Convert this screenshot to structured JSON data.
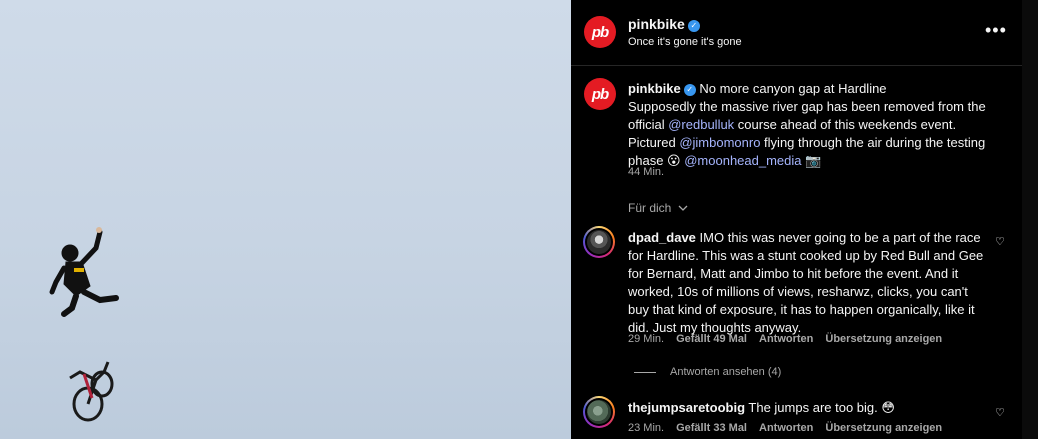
{
  "post": {
    "author": "pinkbike",
    "avatar_text": "pb",
    "subtitle": "Once it's gone it's gone",
    "more_label": "•••",
    "verified_mark": "✓"
  },
  "caption": {
    "author": "pinkbike",
    "part1": "No more canyon gap at Hardline",
    "part2": "Supposedly the massive river gap has been removed from the official ",
    "mention1": "@redbulluk",
    "part3": " course ahead of this weekends event. Pictured ",
    "mention2": "@jimbomonro",
    "part4": " flying through the air during the testing phase ",
    "emoji1": "😮",
    "mention3": "@moonhead_media",
    "emoji2": "📷",
    "time": "44 Min."
  },
  "filter": {
    "label": "Für dich",
    "icon": "chevron-down-icon"
  },
  "comments": [
    {
      "author": "dpad_dave",
      "text": "IMO this was never going to be a part of the race for Hardline. This was a stunt cooked up by Red Bull and Gee for Bernard, Matt and Jimbo to hit before the event. And it worked, 10s of millions of views, resharwz, clicks, you can't buy that kind of exposure, it has to happen organically, like it did. Just my thoughts anyway.",
      "time": "29 Min.",
      "likes": "Gefällt 49 Mal",
      "reply": "Antworten",
      "translate": "Übersetzung anzeigen",
      "view_replies": "Antworten ansehen (4)"
    },
    {
      "author": "thejumpsaretoobig",
      "text": "The jumps are too big. ",
      "emoji": "😳",
      "time": "23 Min.",
      "likes": "Gefällt 33 Mal",
      "reply": "Antworten",
      "translate": "Übersetzung anzeigen"
    }
  ],
  "icons": {
    "heart": "♡"
  },
  "colors": {
    "accent": "#e41b23",
    "verified": "#3897f0",
    "mention": "#a5b4fc",
    "muted": "#a8a8a8"
  }
}
